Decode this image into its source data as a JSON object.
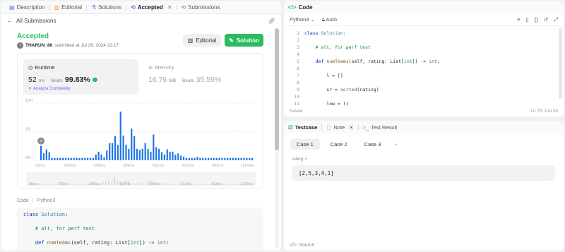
{
  "tabs": [
    {
      "label": "Description",
      "icon": "document-icon"
    },
    {
      "label": "Editorial",
      "icon": "book-icon"
    },
    {
      "label": "Solutions",
      "icon": "flask-icon"
    },
    {
      "label": "Accepted",
      "icon": "history-icon",
      "active": true
    },
    {
      "label": "Submissions",
      "icon": "history-icon"
    }
  ],
  "subheader": {
    "back_label": "All Submissions"
  },
  "submission": {
    "status": "Accepted",
    "avatar_letter": "T",
    "user": "THARUN_86",
    "submitted_text": "submitted at Jul 29, 2024 22:17",
    "editorial_label": "Editorial",
    "solution_label": "Solution"
  },
  "runtime": {
    "label": "Runtime",
    "value": "52",
    "unit": "ms",
    "beats_label": "Beats",
    "beats": "99.83%",
    "analyze_label": "Analyze Complexity"
  },
  "memory": {
    "label": "Memory",
    "value": "16.76",
    "unit": "MB",
    "beats_label": "Beats",
    "beats": "35.59%"
  },
  "chart_data": {
    "type": "bar",
    "y_ticks": [
      "10%",
      "5%",
      "0%"
    ],
    "ylim": [
      0,
      10
    ],
    "x_tick_labels": [
      "55ms",
      "206ms",
      "358ms",
      "509ms",
      "661ms",
      "812ms",
      "963ms",
      "1115ms"
    ],
    "values": [
      2.5,
      1.2,
      1.9,
      1.4,
      0.4,
      0.4,
      0.4,
      0.4,
      0.4,
      0.4,
      0.4,
      0.4,
      0.4,
      0.4,
      0.4,
      0.4,
      0.4,
      0.4,
      0.4,
      0.4,
      1.0,
      1.5,
      1.0,
      0.5,
      1.7,
      3.0,
      3.0,
      4.2,
      2.7,
      8.5,
      4.3,
      2.7,
      2.0,
      5.5,
      4.2,
      2.0,
      1.8,
      2.0,
      3.0,
      2.0,
      1.5,
      4.5,
      2.3,
      2.0,
      1.4,
      1.0,
      1.9,
      1.5,
      1.5,
      1.0,
      1.2,
      0.8,
      0.6,
      0.4,
      0.4,
      0.4,
      0.4,
      0.6,
      0.4,
      0.4,
      0.4,
      0.4,
      0.4,
      0.4,
      0.4,
      0.4,
      0.4,
      0.4,
      0.4,
      0.4,
      0.4,
      0.4,
      0.4,
      0.4,
      0.4,
      0.4,
      0.4,
      0.4
    ],
    "highlight_index": 0,
    "highlight_marker": "T",
    "bar_color": "#1a73e8"
  },
  "code_preview": {
    "label": "Code",
    "lang": "Python3",
    "lines": [
      "class Solution:",
      "    # alt, for perf test",
      "    def numTeams(self, rating: List[int]) -> int:"
    ]
  },
  "code_panel": {
    "title": "Code",
    "language": "Python3",
    "auto_label": "Auto",
    "status_left": "Saved",
    "status_right": "Ln 75, Col 25",
    "line_numbers": [
      "1",
      "2",
      "3",
      "4",
      "5",
      "6",
      "7",
      "8",
      "9",
      "10",
      "11"
    ],
    "lines": [
      "class Solution:",
      "",
      "    # alt, for perf test",
      "",
      "    def numTeams(self, rating: List[int]) -> int:",
      "",
      "        l = []",
      "",
      "        sr = sorted(rating)",
      "",
      "        low = ()"
    ]
  },
  "test_panel": {
    "tabs": [
      "Testcase",
      "Note",
      "Test Result"
    ],
    "cases": [
      "Case 1",
      "Case 2",
      "Case 3"
    ],
    "input_label": "rating =",
    "input_value": "[2,5,3,4,1]",
    "footer": "Source"
  }
}
